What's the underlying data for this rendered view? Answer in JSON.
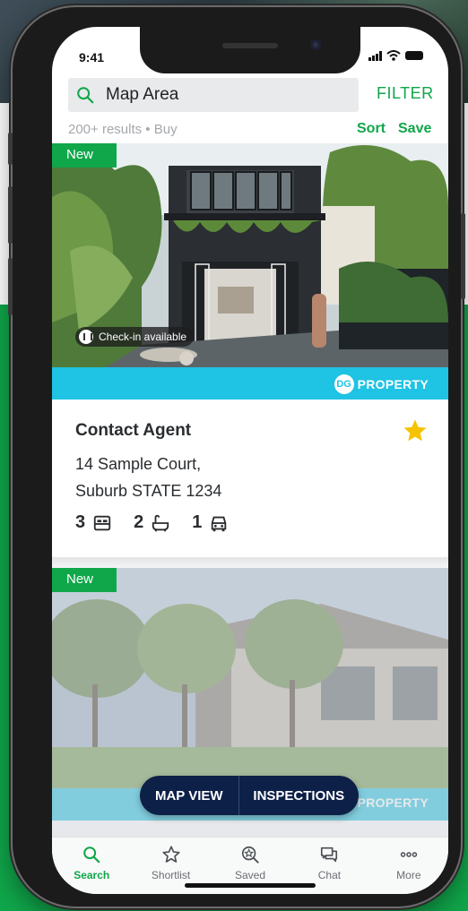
{
  "status_bar": {
    "time": "9:41"
  },
  "search": {
    "value": "Map Area",
    "filter_label": "FILTER",
    "results_text": "200+ results • Buy",
    "sort_label": "Sort",
    "save_label": "Save"
  },
  "listings": [
    {
      "badge": "New",
      "check_in": "Check-in available",
      "agency_initials": "DG",
      "agency_name": "PROPERTY",
      "price": "Contact Agent",
      "address_line1": "14 Sample Court,",
      "address_line2": "Suburb STATE 1234",
      "beds": "3",
      "baths": "2",
      "parking": "1",
      "shortlisted": true
    },
    {
      "badge": "New",
      "agency_name": "PROPERTY"
    }
  ],
  "floating_actions": {
    "map_view": "MAP VIEW",
    "inspections": "INSPECTIONS"
  },
  "tabs": [
    {
      "label": "Search",
      "icon": "search-icon",
      "active": true
    },
    {
      "label": "Shortlist",
      "icon": "star-outline-icon",
      "active": false
    },
    {
      "label": "Saved",
      "icon": "saved-search-icon",
      "active": false
    },
    {
      "label": "Chat",
      "icon": "chat-icon",
      "active": false
    },
    {
      "label": "More",
      "icon": "more-dots-icon",
      "active": false
    }
  ],
  "colors": {
    "brand_green": "#10a64a",
    "agency_blue": "#1fc3e3",
    "navy": "#0d2048",
    "star_yellow": "#f6c300"
  }
}
